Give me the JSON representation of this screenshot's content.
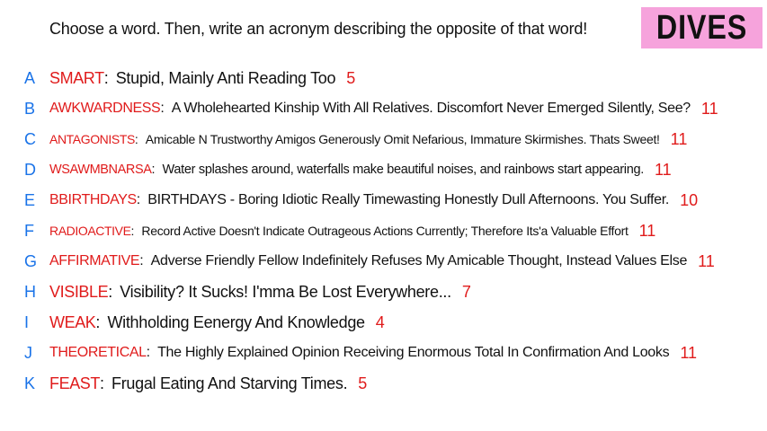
{
  "header": {
    "prompt": "Choose a word. Then, write an acronym describing the opposite of that word!",
    "badge": "DIVES"
  },
  "colors": {
    "letter": "#1a73e8",
    "word": "#e01b1b",
    "text": "#111111",
    "badge_bg": "#f6a3dc"
  },
  "rows": [
    {
      "letter": "A",
      "word": "SMART",
      "colon": ":",
      "acronym": "Stupid, Mainly Anti Reading Too",
      "count": "5"
    },
    {
      "letter": "B",
      "word": "AWKWARDNESS",
      "colon": ":",
      "acronym": "A Wholehearted Kinship With All Relatives. Discomfort Never Emerged Silently, See?",
      "count": "11"
    },
    {
      "letter": "C",
      "word": "ANTAGONISTS",
      "colon": ":",
      "acronym": "Amicable N Trustworthy Amigos Generously Omit Nefarious, Immature Skirmishes. Thats Sweet!",
      "count": "11"
    },
    {
      "letter": "D",
      "word": "WSAWMBNARSA",
      "colon": ":",
      "acronym": "Water splashes around, waterfalls make beautiful noises, and rainbows start appearing.",
      "count": "11"
    },
    {
      "letter": "E",
      "word": "BBIRTHDAYS",
      "colon": ":",
      "acronym": "BIRTHDAYS - Boring Idiotic Really Timewasting Honestly Dull Afternoons. You Suffer.",
      "count": "10"
    },
    {
      "letter": "F",
      "word": "RADIOACTIVE",
      "colon": ":",
      "acronym": "Record Active Doesn't Indicate Outrageous Actions Currently; Therefore Its'a Valuable Effort",
      "count": "11"
    },
    {
      "letter": "G",
      "word": "AFFIRMATIVE",
      "colon": ":",
      "acronym": "Adverse Friendly Fellow Indefinitely Refuses My Amicable Thought, Instead Values Else",
      "count": "11"
    },
    {
      "letter": "H",
      "word": "VISIBLE",
      "colon": ":",
      "acronym": "Visibility? It Sucks! I'mma Be Lost Everywhere...",
      "count": "7"
    },
    {
      "letter": "I",
      "word": "WEAK",
      "colon": ":",
      "acronym": "Withholding Eenergy And Knowledge",
      "count": "4"
    },
    {
      "letter": "J",
      "word": "THEORETICAL",
      "colon": ":",
      "acronym": "The Highly Explained Opinion Receiving Enormous Total In Confirmation And Looks",
      "count": "11"
    },
    {
      "letter": "K",
      "word": "FEAST",
      "colon": ":",
      "acronym": "Frugal Eating And Starving Times.",
      "count": "5"
    }
  ]
}
